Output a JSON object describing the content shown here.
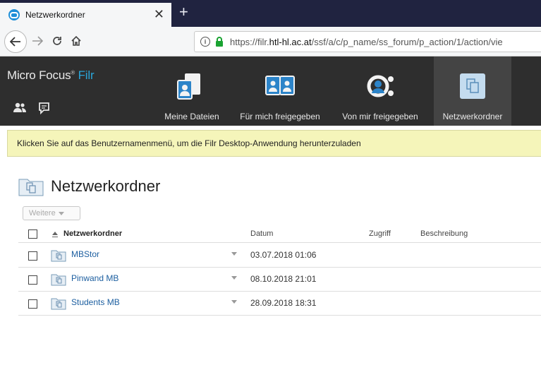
{
  "browser": {
    "tab_title": "Netzwerkordner",
    "tab_close": "✕",
    "new_tab": "+",
    "url_prefix": "https://filr.",
    "url_host": "htl-hl.ac.at",
    "url_path": "/ssf/a/c/p_name/ss_forum/p_action/1/action/vie"
  },
  "app": {
    "logo_text": "Micro Focus",
    "logo_brand": "Filr",
    "nav_tabs": [
      {
        "label": "Meine Dateien"
      },
      {
        "label": "Für mich freigegeben"
      },
      {
        "label": "Von mir freigegeben"
      },
      {
        "label": "Netzwerkordner"
      }
    ]
  },
  "infobar": {
    "text": "Klicken Sie auf das Benutzernamenmenü, um die Filr Desktop-Anwendung herunterzuladen"
  },
  "page": {
    "title": "Netzwerkordner",
    "weitere_label": "Weitere",
    "columns": {
      "name": "Netzwerkordner",
      "date": "Datum",
      "access": "Zugriff",
      "description": "Beschreibung"
    }
  },
  "rows": [
    {
      "name": "MBStor",
      "date": "03.07.2018 01:06"
    },
    {
      "name": "Pinwand MB",
      "date": "08.10.2018 21:01"
    },
    {
      "name": "Students MB",
      "date": "28.09.2018 18:31"
    }
  ],
  "colors": {
    "accent": "#2aa5d8",
    "header_bg": "#2e2e2e",
    "infobar_bg": "#f5f5ba",
    "link": "#1d5fa0"
  }
}
